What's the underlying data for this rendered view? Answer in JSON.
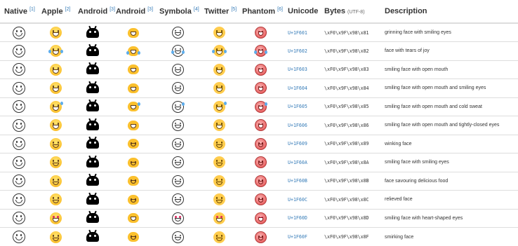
{
  "columns": [
    {
      "label": "Native",
      "ref": "[1]"
    },
    {
      "label": "Apple",
      "ref": "[2]"
    },
    {
      "label": "Android",
      "ref": "[3]"
    },
    {
      "label": "Android",
      "ref": "[3]"
    },
    {
      "label": "Symbola",
      "ref": "[4]"
    },
    {
      "label": "Twitter",
      "ref": "[5]"
    },
    {
      "label": "Phantom",
      "ref": "[6]"
    },
    {
      "label": "Unicode",
      "ref": ""
    },
    {
      "label": "Bytes",
      "ref": "(UTF-8)"
    },
    {
      "label": "Description",
      "ref": ""
    }
  ],
  "rows": [
    {
      "code": "U+1F601",
      "bytes": "\\xF0\\x9F\\x98\\x81",
      "description": "grinning face with smiling eyes",
      "variant": "grin"
    },
    {
      "code": "U+1F602",
      "bytes": "\\xF0\\x9F\\x98\\x82",
      "description": "face with tears of joy",
      "variant": "tears"
    },
    {
      "code": "U+1F603",
      "bytes": "\\xF0\\x9F\\x98\\x83",
      "description": "smiling face with open mouth",
      "variant": "open"
    },
    {
      "code": "U+1F604",
      "bytes": "\\xF0\\x9F\\x98\\x84",
      "description": "smiling face with open mouth and smiling eyes",
      "variant": "open"
    },
    {
      "code": "U+1F605",
      "bytes": "\\xF0\\x9F\\x98\\x85",
      "description": "smiling face with open mouth and cold sweat",
      "variant": "sweat"
    },
    {
      "code": "U+1F606",
      "bytes": "\\xF0\\x9F\\x98\\x86",
      "description": "smiling face with open mouth and tightly-closed eyes",
      "variant": "open"
    },
    {
      "code": "U+1F609",
      "bytes": "\\xF0\\x9F\\x98\\x89",
      "description": "winking face",
      "variant": "wink"
    },
    {
      "code": "U+1F60A",
      "bytes": "\\xF0\\x9F\\x98\\x8A",
      "description": "smiling face with smiling eyes",
      "variant": "smile"
    },
    {
      "code": "U+1F60B",
      "bytes": "\\xF0\\x9F\\x98\\x8B",
      "description": "face savouring delicious food",
      "variant": "smile"
    },
    {
      "code": "U+1F60C",
      "bytes": "\\xF0\\x9F\\x98\\x8C",
      "description": "relieved face",
      "variant": "smile"
    },
    {
      "code": "U+1F60D",
      "bytes": "\\xF0\\x9F\\x98\\x8D",
      "description": "smiling face with heart-shaped eyes",
      "variant": "heart"
    },
    {
      "code": "U+1F60F",
      "bytes": "\\xF0\\x9F\\x98\\x8F",
      "description": "smirking face",
      "variant": "smirk"
    }
  ],
  "colors": {
    "link": "#337ab7",
    "border": "#dddddd",
    "text": "#333333",
    "apple_yellow": "#fbc02d",
    "twitter_yellow": "#ffcc4d",
    "phantom_red": "#e85a5a"
  },
  "icons": {
    "native": "outline-smiley-icon",
    "apple": "apple-emoji-icon",
    "android_legacy": "android-robot-emoji-icon",
    "android_noto": "android-blob-emoji-icon",
    "symbola": "symbola-outline-emoji-icon",
    "twitter": "twemoji-icon",
    "phantom": "phantom-emoji-icon"
  }
}
